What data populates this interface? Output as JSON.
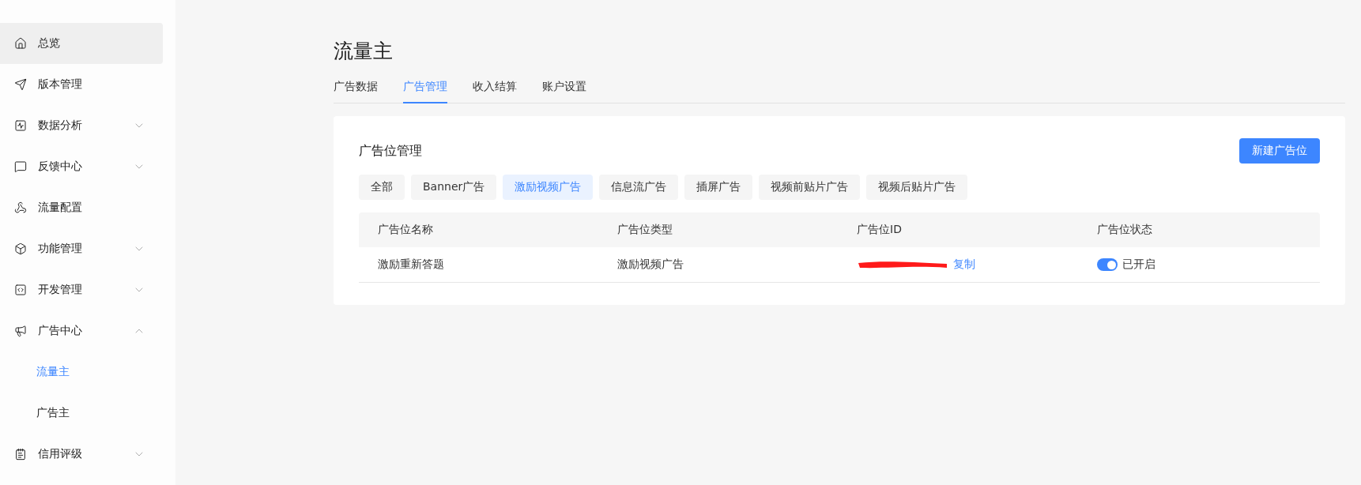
{
  "sidebar": {
    "items": [
      {
        "label": "总览",
        "kind": "link",
        "highlighted": true
      },
      {
        "label": "版本管理",
        "kind": "link",
        "highlighted": false
      },
      {
        "label": "数据分析",
        "kind": "group",
        "highlighted": false,
        "expanded": false
      },
      {
        "label": "反馈中心",
        "kind": "group",
        "highlighted": false,
        "expanded": false
      },
      {
        "label": "流量配置",
        "kind": "link",
        "highlighted": false
      },
      {
        "label": "功能管理",
        "kind": "group",
        "highlighted": false,
        "expanded": false
      },
      {
        "label": "开发管理",
        "kind": "group",
        "highlighted": false,
        "expanded": false
      },
      {
        "label": "广告中心",
        "kind": "group",
        "highlighted": false,
        "expanded": true,
        "children": [
          {
            "label": "流量主",
            "selected": true
          },
          {
            "label": "广告主",
            "selected": false
          }
        ]
      },
      {
        "label": "信用评级",
        "kind": "group",
        "highlighted": false,
        "expanded": false
      }
    ]
  },
  "page": {
    "title": "流量主",
    "tabs": [
      {
        "label": "广告数据",
        "selected": false
      },
      {
        "label": "广告管理",
        "selected": true
      },
      {
        "label": "收入结算",
        "selected": false
      },
      {
        "label": "账户设置",
        "selected": false
      }
    ],
    "card": {
      "title": "广告位管理",
      "new_button": "新建广告位",
      "filters": [
        {
          "label": "全部",
          "selected": false
        },
        {
          "label": "Banner广告",
          "selected": false
        },
        {
          "label": "激励视频广告",
          "selected": true
        },
        {
          "label": "信息流广告",
          "selected": false
        },
        {
          "label": "插屏广告",
          "selected": false
        },
        {
          "label": "视频前贴片广告",
          "selected": false
        },
        {
          "label": "视频后贴片广告",
          "selected": false
        }
      ],
      "table": {
        "columns": [
          "广告位名称",
          "广告位类型",
          "广告位ID",
          "广告位状态"
        ],
        "rows": [
          {
            "name": "激励重新答题",
            "type": "激励视频广告",
            "id_redacted": true,
            "copy_link": "复制",
            "on": true,
            "status": "已开启"
          }
        ]
      }
    }
  }
}
